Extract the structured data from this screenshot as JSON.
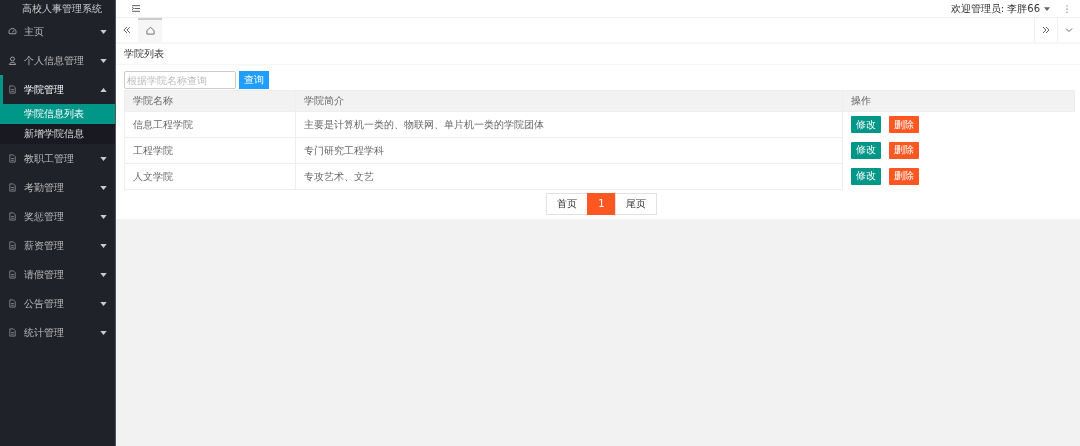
{
  "app_title": "高校人事管理系统",
  "menu": [
    {
      "label": "主页",
      "kind": "gauge",
      "expanded": false,
      "selected": false
    },
    {
      "label": "个人信息管理",
      "kind": "user",
      "expanded": false,
      "selected": false
    },
    {
      "label": "学院管理",
      "kind": "doc",
      "expanded": true,
      "selected": true,
      "children": [
        {
          "label": "学院信息列表",
          "selected": true
        },
        {
          "label": "新增学院信息",
          "selected": false
        }
      ]
    },
    {
      "label": "教职工管理",
      "kind": "doc",
      "expanded": false,
      "selected": false
    },
    {
      "label": "考勤管理",
      "kind": "doc",
      "expanded": false,
      "selected": false
    },
    {
      "label": "奖惩管理",
      "kind": "doc",
      "expanded": false,
      "selected": false
    },
    {
      "label": "薪资管理",
      "kind": "doc",
      "expanded": false,
      "selected": false
    },
    {
      "label": "请假管理",
      "kind": "doc",
      "expanded": false,
      "selected": false
    },
    {
      "label": "公告管理",
      "kind": "doc",
      "expanded": false,
      "selected": false
    },
    {
      "label": "统计管理",
      "kind": "doc",
      "expanded": false,
      "selected": false
    }
  ],
  "header": {
    "user": "欢迎管理员: 李胖66"
  },
  "tabs": [
    {
      "kind": "home",
      "selected": true
    }
  ],
  "page_title": "学院列表",
  "search": {
    "placeholder": "根据学院名称查询",
    "button": "查询"
  },
  "table": {
    "columns": [
      "学院名称",
      "学院简介",
      "操作"
    ],
    "rows": [
      {
        "name": "信息工程学院",
        "intro": "主要是计算机一类的、物联网、单片机一类的学院团体",
        "actions": [
          "修改",
          "删除"
        ]
      },
      {
        "name": "工程学院",
        "intro": "专门研究工程学科",
        "actions": [
          "修改",
          "删除"
        ]
      },
      {
        "name": "人文学院",
        "intro": "专攻艺术、文艺",
        "actions": [
          "修改",
          "删除"
        ]
      }
    ]
  },
  "pagination": [
    {
      "label": "首页",
      "selected": false
    },
    {
      "label": "1",
      "selected": true
    },
    {
      "label": "尾页",
      "selected": false
    }
  ]
}
